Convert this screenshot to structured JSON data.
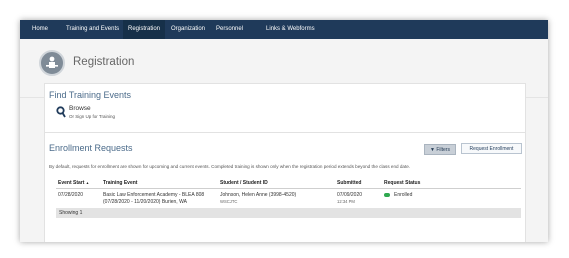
{
  "nav": {
    "items": [
      {
        "label": "Home"
      },
      {
        "label": "Training and Events"
      },
      {
        "label": "Registration"
      },
      {
        "label": "Organization"
      },
      {
        "label": "Personnel"
      },
      {
        "label": "Links & Webforms"
      }
    ],
    "active": "Registration"
  },
  "header": {
    "title": "Registration",
    "logo_icon": "person-at-desk-icon"
  },
  "find_section": {
    "title": "Find Training Events",
    "browse_title": "Browse",
    "browse_subtitle": "Or Sign Up for Training",
    "browse_icon": "search-icon"
  },
  "enrollment": {
    "title": "Enrollment Requests",
    "filters_label": "Filters",
    "request_button_label": "Request Enrollment",
    "description": "By default, requests for enrollment are shown for upcoming and current events. Completed training is shown only when the registration period extends beyond the class end date.",
    "columns": [
      "Event Start",
      "Training Event",
      "Student / Student ID",
      "Submitted",
      "Request Status"
    ],
    "sort_indicator": "▲",
    "rows": [
      {
        "event_start": "07/28/2020",
        "event_name": "Basic Law Enforcement Academy - BLEA 808",
        "event_dates": "(07/28/2020 - 11/20/2020) Burien, WA",
        "student": "Johnson, Helen Anne (3998-4520)",
        "student_org": "WSCJTC",
        "submitted_date": "07/09/2020",
        "submitted_time": "12:34 PM",
        "status": "Enrolled",
        "status_color": "#2fa84f"
      }
    ],
    "showing_text": "Showing 1"
  },
  "colors": {
    "nav_bg": "#1f3a5a",
    "title_blue": "#4b6b8a"
  }
}
